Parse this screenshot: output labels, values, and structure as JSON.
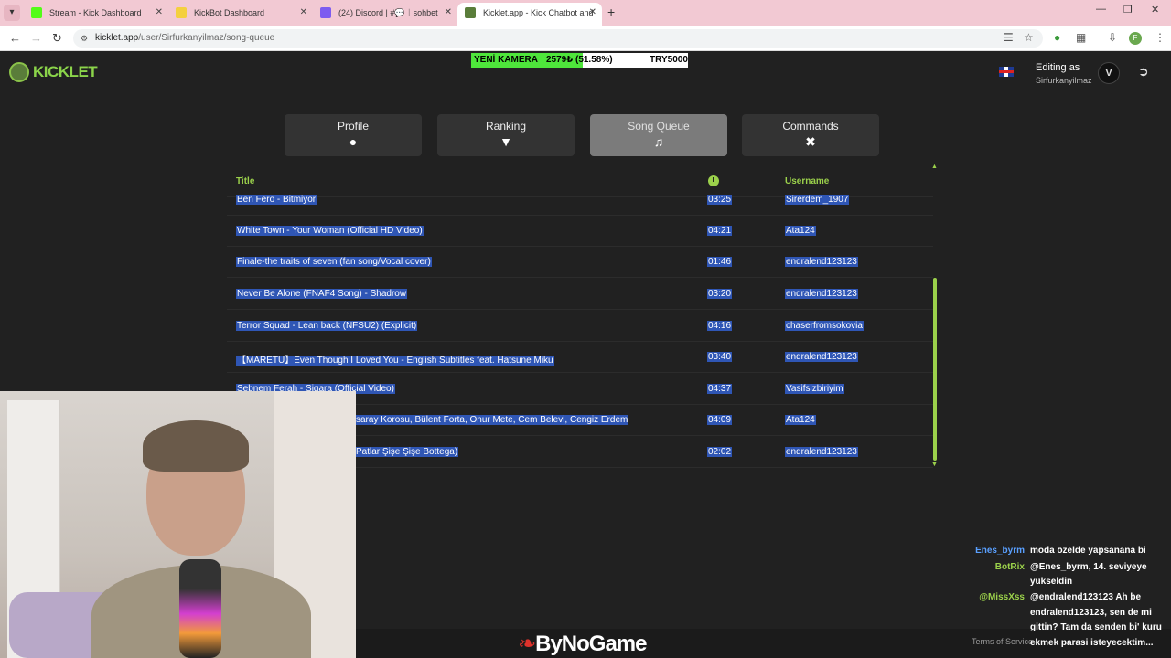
{
  "browser": {
    "tabs": [
      {
        "title": "Stream - Kick Dashboard",
        "favicon_color": "#53fc18",
        "active": false
      },
      {
        "title": "KickBot Dashboard",
        "favicon_color": "#f4d03f",
        "active": false
      },
      {
        "title": "(24) Discord | #💬︱sohbet",
        "favicon_color": "#7d5cf0",
        "active": false
      },
      {
        "title": "Kicklet.app - Kick Chatbot and",
        "favicon_color": "#5a7d3a",
        "active": true
      }
    ],
    "url_domain": "kicklet.app",
    "url_path": "/user/Sirfurkanyilmaz/song-queue",
    "profile_initial": "F"
  },
  "banner": {
    "label": "YENİ KAMERA",
    "amount": "2579₺ (51.58%)",
    "goal": "TRY5000",
    "progress": 0.5158
  },
  "header": {
    "brand": "KICKLET",
    "editing_label": "Editing as",
    "username": "Sirfurkanyilmaz"
  },
  "nav": [
    {
      "label": "Profile",
      "icon": "👤",
      "active": false
    },
    {
      "label": "Ranking",
      "icon": "🏆",
      "active": false
    },
    {
      "label": "Song Queue",
      "icon": "≡♪",
      "active": true
    },
    {
      "label": "Commands",
      "icon": "⚒",
      "active": false
    }
  ],
  "table": {
    "headers": {
      "title": "Title",
      "username": "Username"
    },
    "rows": [
      {
        "title": "Ben Fero - Bitmiyor",
        "duration": "03:25",
        "username": "Sirerdem_1907"
      },
      {
        "title": "White Town - Your Woman (Official HD Video)",
        "duration": "04:21",
        "username": "Ata124"
      },
      {
        "title": "Finale-the traits of seven (fan song/Vocal cover)",
        "duration": "01:46",
        "username": "endralend123123"
      },
      {
        "title": "Never Be Alone (FNAF4 Song) - Shadrow",
        "duration": "03:20",
        "username": "endralend123123"
      },
      {
        "title": "Terror Squad - Lean back (NFSU2) (Explicit)",
        "duration": "04:16",
        "username": "chaserfromsokovia"
      },
      {
        "title": "【MARETU】Even Though I Loved You - English Subtitles feat. Hatsune Miku",
        "duration": "03:40",
        "username": "endralend123123"
      },
      {
        "title": "Sebnem Ferah - Sigara (Official Video)",
        "duration": "04:37",
        "username": "Vasifsizbiriyim"
      },
      {
        "title": "saray Korosu, Bülent Forta, Onur Mete, Cem Belevi, Cengiz Erdem",
        "duration": "04:09",
        "username": "Ata124"
      },
      {
        "title": "Patlar Şişe Şişe Bottega)",
        "duration": "02:02",
        "username": "endralend123123"
      }
    ]
  },
  "sponsor": "ByNoGame",
  "terms": "Terms of Service",
  "chat": [
    {
      "user": "Enes_byrm",
      "color": "#5aa0ff",
      "lines": [
        "moda özelde yapsanana bi"
      ]
    },
    {
      "user": "BotRix",
      "color": "#9bd14b",
      "lines": [
        "@Enes_byrm, 14. seviyeye",
        "yükseldin"
      ]
    },
    {
      "user": "@MissXss",
      "color": "#9bd14b",
      "lines": [
        "@endralend123123 Ah be",
        "endralend123123, sen de mi",
        "gittin? Tam da senden bi' kuru",
        "ekmek parasi isteyecektim..."
      ]
    }
  ]
}
